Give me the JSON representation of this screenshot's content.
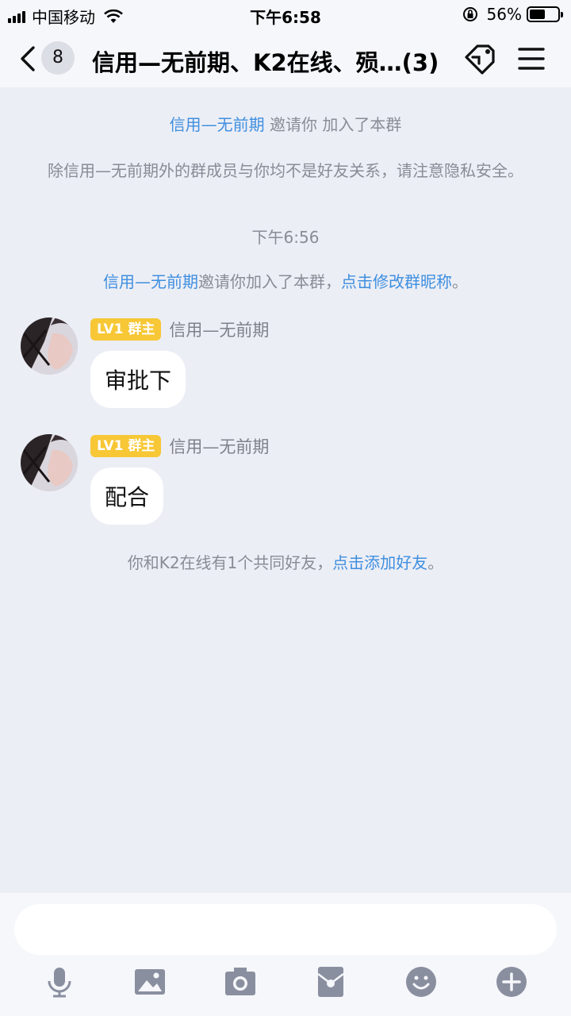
{
  "status_bar": {
    "carrier": "中国移动",
    "time": "下午6:58",
    "battery_percent": "56%",
    "battery_level": 0.56,
    "icons": [
      "signal-icon",
      "wifi-icon",
      "rotation-lock-icon",
      "battery-icon"
    ]
  },
  "header": {
    "unread_count": "8",
    "title": "信用—无前期、K2在线、殒…(3)",
    "icons": [
      "back-icon",
      "group-tag-icon",
      "menu-icon"
    ]
  },
  "chat": {
    "system_messages": [
      {
        "link": "信用—无前期",
        "text": " 邀请你 加入了本群"
      },
      {
        "text": "除信用—无前期外的群成员与你均不是好友关系，请注意隐私安全。"
      },
      {
        "text": "下午6:56"
      },
      {
        "link": "信用—无前期",
        "text": "邀请你加入了本群，",
        "link2": "点击修改群昵称",
        "tail": "。"
      }
    ],
    "messages": [
      {
        "level": "LV1 群主",
        "sender": "信用—无前期",
        "text": "审批下"
      },
      {
        "level": "LV1 群主",
        "sender": "信用—无前期",
        "text": "配合"
      }
    ],
    "friend_notice": {
      "text": "你和K2在线有1个共同好友，",
      "link": "点击添加好友",
      "tail": "。"
    }
  },
  "input": {
    "placeholder": "",
    "tools": [
      "microphone-icon",
      "image-icon",
      "camera-icon",
      "red-packet-icon",
      "emoji-icon",
      "plus-icon"
    ]
  },
  "colors": {
    "link": "#3f8fe0",
    "badge": "#f7c736",
    "background": "#eceef5"
  }
}
